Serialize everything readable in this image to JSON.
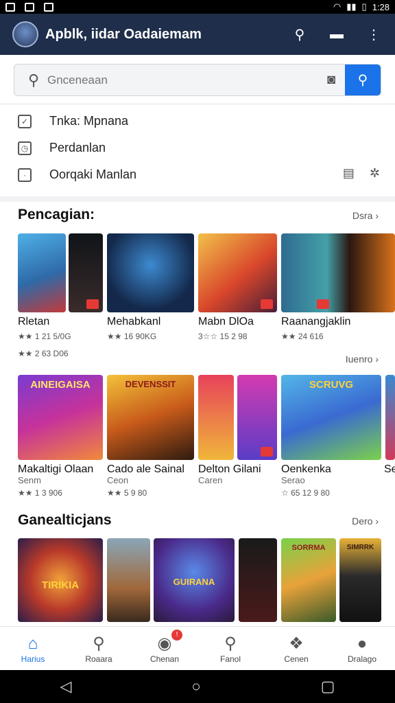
{
  "status": {
    "time": "1:28"
  },
  "appbar": {
    "title": "Apblk, iidar Oadaiemam"
  },
  "search": {
    "placeholder": "Gnceneaan"
  },
  "quick": {
    "items": [
      "Tnka: Mpnana",
      "Perdanlan",
      "Oorqaki Manlan"
    ]
  },
  "sections": [
    {
      "title": "Pencagian:",
      "more": "Dsra"
    },
    {
      "title": "Ganealticjans",
      "more": "Dero"
    }
  ],
  "row1": [
    {
      "name": "Rletan",
      "rating": "★★ 1 21 5/0G",
      "extra": "★★ 2 63 D06"
    },
    {
      "name": "Mehabkanl",
      "rating": "★★ 16 90KG"
    },
    {
      "name": "Mabn DlOa",
      "rating": "3☆☆ 15 2 98"
    },
    {
      "name": "Raanangjaklin",
      "rating": "★★ 24 616"
    }
  ],
  "row1_more": "Iuenro",
  "row2": [
    {
      "name": "Makaltigi Olaan",
      "sub": "Senm",
      "rating": "★★ 1 3 906",
      "art": "AINEIGAISA"
    },
    {
      "name": "Cado ale Sainal",
      "sub": "Ceon",
      "rating": "★★ 5 9 80",
      "art": "DEVENSSIT"
    },
    {
      "name": "Delton Gilani",
      "sub": "Caren",
      "rating": ""
    },
    {
      "name": "Oenkenka",
      "sub": "Serao",
      "rating": "☆ 65 12 9 80",
      "art": "SCRUVG"
    },
    {
      "name": "Se",
      "sub": "",
      "rating": ""
    }
  ],
  "row3_art": [
    "TIRIKIA",
    "GUIRANA",
    "",
    "SORRMA",
    "SIMRRK"
  ],
  "nav": [
    {
      "label": "Harius",
      "icon": "home-icon"
    },
    {
      "label": "Roaara",
      "icon": "search-icon"
    },
    {
      "label": "Chenan",
      "icon": "chat-icon",
      "badge": "!"
    },
    {
      "label": "Fanol",
      "icon": "explore-icon"
    },
    {
      "label": "Cenen",
      "icon": "apps-icon"
    },
    {
      "label": "Dralago",
      "icon": "profile-icon"
    }
  ],
  "colors": {
    "appbar": "#1f2e4a",
    "accent": "#1a73e8"
  }
}
